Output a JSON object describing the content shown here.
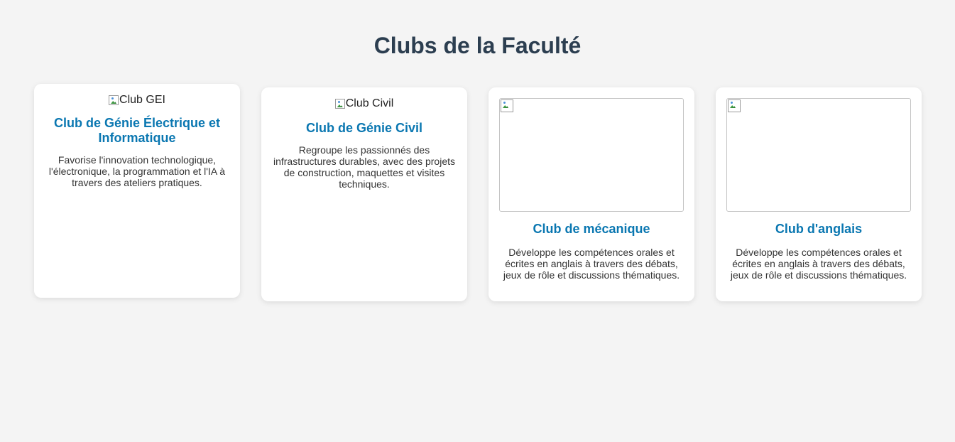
{
  "page": {
    "title": "Clubs de la Faculté"
  },
  "clubs": [
    {
      "image_alt": "Club GEI",
      "title": "Club de Génie Électrique et Informatique",
      "description": "Favorise l'innovation technologique, l'électronique, la programmation et l'IA à travers des ateliers pratiques."
    },
    {
      "image_alt": "Club Civil",
      "title": "Club de Génie Civil",
      "description": "Regroupe les passionnés des infrastructures durables, avec des projets de construction, maquettes et visites techniques."
    },
    {
      "image_alt": "",
      "title": "Club de mécanique",
      "description": "Développe les compétences orales et écrites en anglais à travers des débats, jeux de rôle et discussions thématiques."
    },
    {
      "image_alt": "",
      "title": "Club d'anglais",
      "description": "Développe les compétences orales et écrites en anglais à travers des débats, jeux de rôle et discussions thématiques."
    }
  ],
  "colors": {
    "background": "#f4f4f4",
    "title": "#2c3e50",
    "card_title": "#0a77b1",
    "card_background": "#ffffff"
  },
  "icons": {
    "broken_image": "broken-image-icon"
  }
}
